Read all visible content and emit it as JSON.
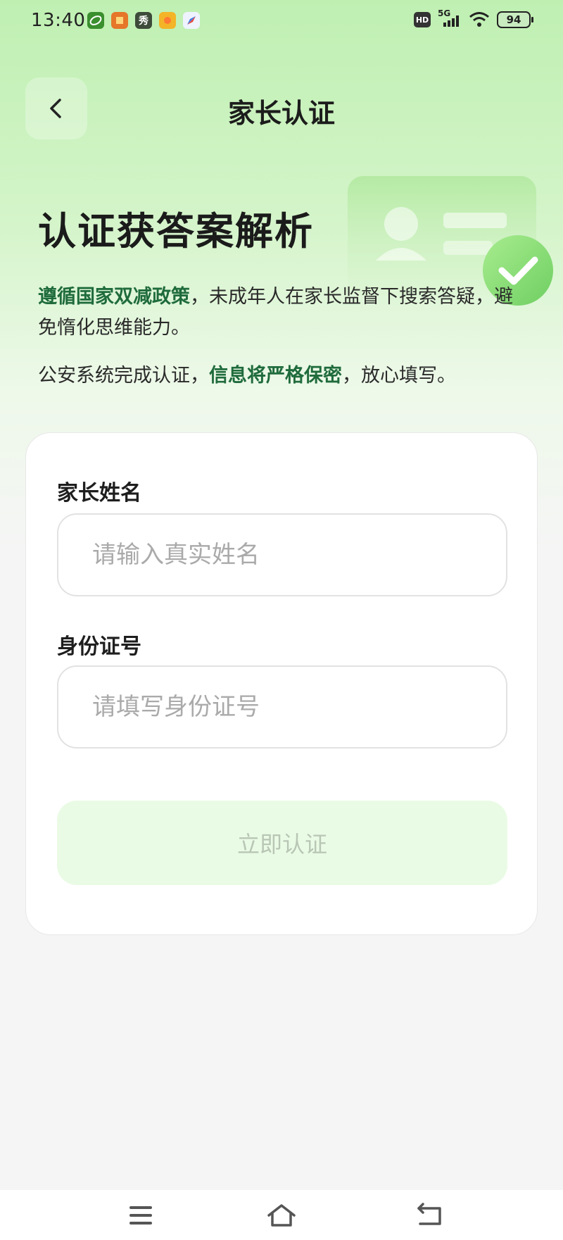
{
  "status_bar": {
    "time": "13:40",
    "network": "5G",
    "hd": "HD",
    "battery": "94",
    "notification_icons": [
      "app-icon",
      "app-icon",
      "秀",
      "app-icon",
      "app-icon"
    ]
  },
  "header": {
    "title": "家长认证",
    "back_icon": "chevron-left-icon"
  },
  "hero": {
    "title": "认证获答案解析",
    "line1_highlight": "遵循国家双减政策",
    "line1_rest": "，未成年人在家长监督下搜索答疑，避免惰化思维能力。",
    "line2_start": "公安系统完成认证，",
    "line2_highlight": "信息将严格保密",
    "line2_end": "，放心填写。"
  },
  "form": {
    "name_label": "家长姓名",
    "name_placeholder": "请输入真实姓名",
    "name_value": "",
    "id_label": "身份证号",
    "id_placeholder": "请填写身份证号",
    "id_value": "",
    "submit_label": "立即认证"
  },
  "colors": {
    "accent_green": "#1f6b3c",
    "check_green": "#7fd86e",
    "button_bg": "#eafbe5",
    "button_text": "#b8c6b5"
  },
  "nav": {
    "icons": [
      "menu-icon",
      "home-icon",
      "back-icon"
    ]
  }
}
